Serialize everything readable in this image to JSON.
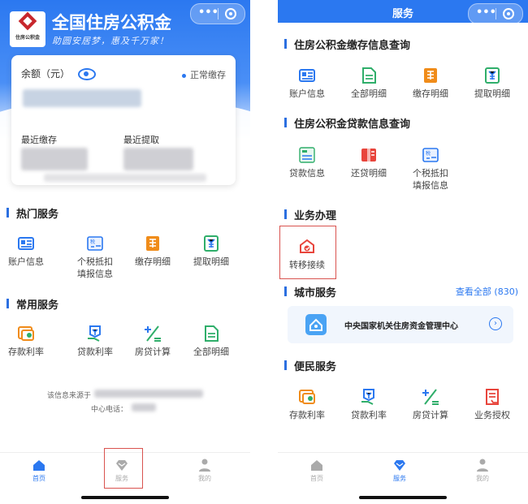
{
  "left": {
    "brand_title": "全国住房公积金",
    "slogan": "助圆安居梦，惠及千万家！",
    "logo_text": "住房公积金",
    "balance_label": "余额（元）",
    "status": "正常缴存",
    "recent_deposit_label": "最近缴存",
    "recent_withdraw_label": "最近提取",
    "hot_services_title": "热门服务",
    "hot_services": [
      {
        "label": "账户信息",
        "icon": "account-icon"
      },
      {
        "label": "个税抵扣\n填报信息",
        "icon": "tax-icon"
      },
      {
        "label": "缴存明细",
        "icon": "deposit-detail-icon"
      },
      {
        "label": "提取明细",
        "icon": "withdraw-detail-icon"
      }
    ],
    "common_services_title": "常用服务",
    "common_services": [
      {
        "label": "存款利率",
        "icon": "deposit-rate-icon"
      },
      {
        "label": "贷款利率",
        "icon": "loan-rate-icon"
      },
      {
        "label": "房贷计算",
        "icon": "calculator-icon"
      },
      {
        "label": "全部明细",
        "icon": "document-icon"
      }
    ],
    "source_prefix": "该信息来源于",
    "phone_label": "中心电话：",
    "tabs": [
      {
        "label": "首页",
        "icon": "home-icon",
        "active": true
      },
      {
        "label": "服务",
        "icon": "diamond-icon",
        "active": false
      },
      {
        "label": "我的",
        "icon": "person-icon",
        "active": false
      }
    ]
  },
  "right": {
    "title": "服务",
    "sec1_title": "住房公积金缴存信息查询",
    "sec1_items": [
      {
        "label": "账户信息",
        "icon": "account-icon"
      },
      {
        "label": "全部明细",
        "icon": "document-icon"
      },
      {
        "label": "缴存明细",
        "icon": "deposit-detail-icon"
      },
      {
        "label": "提取明细",
        "icon": "withdraw-detail-icon"
      }
    ],
    "sec2_title": "住房公积金贷款信息查询",
    "sec2_items": [
      {
        "label": "贷款信息",
        "icon": "loan-info-icon"
      },
      {
        "label": "还贷明细",
        "icon": "repay-icon"
      },
      {
        "label": "个税抵扣\n填报信息",
        "icon": "tax-icon"
      }
    ],
    "sec3_title": "业务办理",
    "sec3_items": [
      {
        "label": "转移接续",
        "icon": "transfer-icon"
      }
    ],
    "city_title": "城市服务",
    "city_more": "查看全部 (830)",
    "city_card": "中央国家机关住房资金管理中心",
    "sec5_title": "便民服务",
    "sec5_items": [
      {
        "label": "存款利率",
        "icon": "deposit-rate-icon"
      },
      {
        "label": "贷款利率",
        "icon": "loan-rate-icon"
      },
      {
        "label": "房贷计算",
        "icon": "calculator-icon"
      },
      {
        "label": "业务授权",
        "icon": "authorize-icon"
      }
    ],
    "tabs": [
      {
        "label": "首页",
        "icon": "home-icon",
        "active": false
      },
      {
        "label": "服务",
        "icon": "diamond-icon",
        "active": true
      },
      {
        "label": "我的",
        "icon": "person-icon",
        "active": false
      }
    ]
  },
  "colors": {
    "accent": "#2b78f0",
    "highlight_box": "#d9534f",
    "icon_orange": "#f08c1a",
    "icon_green": "#2fae6a"
  }
}
